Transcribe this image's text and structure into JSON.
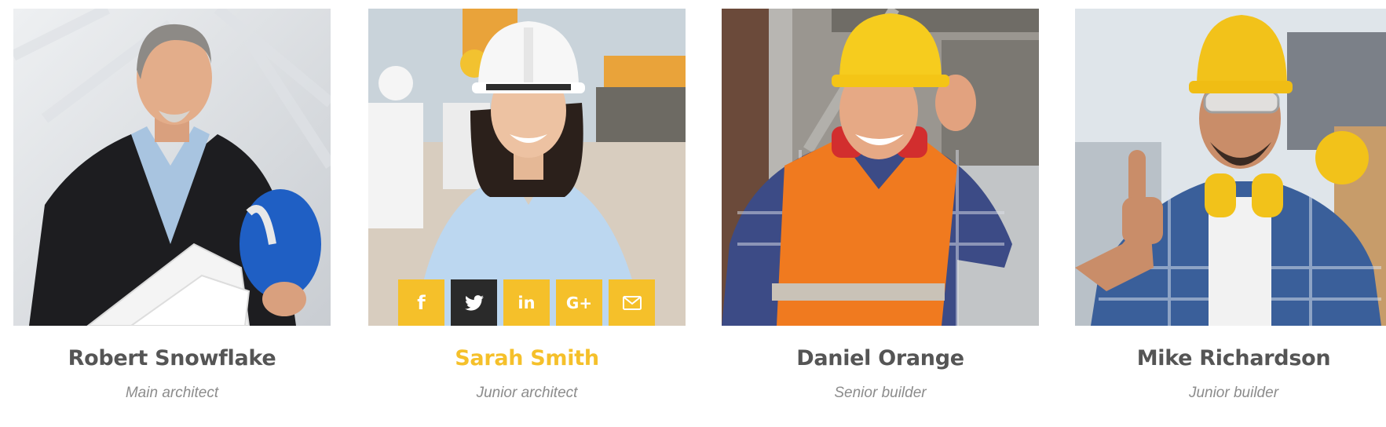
{
  "team": {
    "members": [
      {
        "name": "Robert Snowflake",
        "role": "Main architect",
        "photo": "man-in-suit-holding-blueprints-and-blue-helmet"
      },
      {
        "name": "Sarah Smith",
        "role": "Junior architect",
        "photo": "woman-in-white-hard-hat-on-site",
        "highlighted": true
      },
      {
        "name": "Daniel Orange",
        "role": "Senior builder",
        "photo": "man-in-yellow-hard-hat-and-orange-vest"
      },
      {
        "name": "Mike Richardson",
        "role": "Junior builder",
        "photo": "man-in-yellow-hard-hat-thumbs-up"
      }
    ],
    "social": [
      {
        "icon": "facebook-icon",
        "glyph": "f"
      },
      {
        "icon": "twitter-icon",
        "glyph": "",
        "active": true
      },
      {
        "icon": "linkedin-icon",
        "glyph": "in"
      },
      {
        "icon": "google-plus-icon",
        "glyph": "G+"
      },
      {
        "icon": "envelope-icon",
        "glyph": ""
      }
    ]
  },
  "colors": {
    "accent": "#f5c02a",
    "active_button": "#2a2a2a",
    "name_text": "#555555",
    "role_text": "#8c8c8c"
  }
}
